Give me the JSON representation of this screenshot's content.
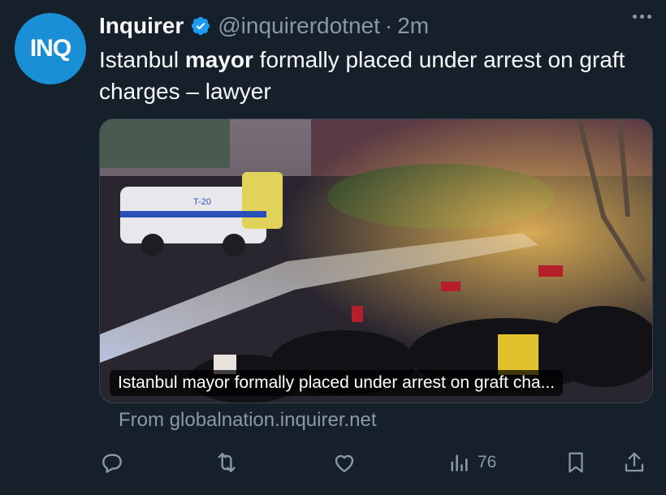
{
  "tweet": {
    "avatar_text": "INQ",
    "display_name": "Inquirer",
    "handle": "@inquirerdotnet",
    "separator": "·",
    "time": "2m",
    "text_before": "Istanbul ",
    "text_bold": "mayor",
    "text_after": " formally placed under arrest on graft charges – lawyer"
  },
  "card": {
    "caption": "Istanbul mayor formally placed under arrest on graft cha...",
    "source": "From globalnation.inquirer.net",
    "truck_label": "T-20"
  },
  "actions": {
    "views": "76"
  },
  "colors": {
    "background": "#15202b",
    "avatar": "#1a8fd6",
    "verified": "#1d9bf0",
    "muted": "#8b98a5"
  }
}
